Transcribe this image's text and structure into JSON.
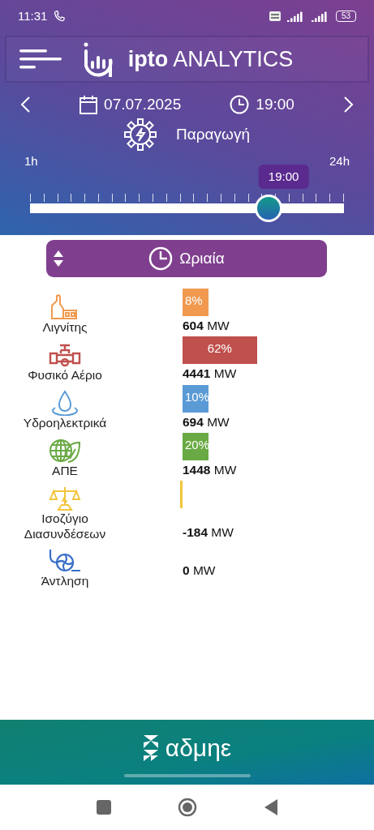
{
  "status_bar": {
    "time": "11:31",
    "battery": "53"
  },
  "header": {
    "title": "**ipto** ANALYTICS"
  },
  "date_nav": {
    "date": "07.07.2025",
    "time": "19:00"
  },
  "section": "Παραγωγή",
  "slider": {
    "min_label": "1h",
    "max_label": "24h",
    "tooltip": "19:00",
    "level": 0.76
  },
  "period_select": {
    "label": "Ωριαία"
  },
  "sources": [
    {
      "name": "Λιγνίτης",
      "kind": "bar",
      "percent": "8%",
      "color": "#f0994f",
      "value": "604",
      "unit": "MW"
    },
    {
      "name": "Φυσικό Αέριο",
      "kind": "bar",
      "percent": "62%",
      "color": "#c0504d",
      "value": "4441",
      "unit": "MW"
    },
    {
      "name": "Υδροηλεκτρικά",
      "kind": "bar",
      "percent": "10%",
      "color": "#5b9bd5",
      "value": "694",
      "unit": "MW"
    },
    {
      "name": "ΑΠΕ",
      "kind": "bar",
      "percent": "20%",
      "color": "#6aaa45",
      "value": "1448",
      "unit": "MW"
    },
    {
      "name": "Ισοζύγιο Διασυνδέσεων",
      "kind": "line",
      "color": "#f2c53d",
      "value": "-184",
      "unit": "MW"
    },
    {
      "name": "Άντληση",
      "kind": "none",
      "value": "0",
      "unit": "MW"
    }
  ],
  "footer": {
    "brand": "αδμηε"
  }
}
